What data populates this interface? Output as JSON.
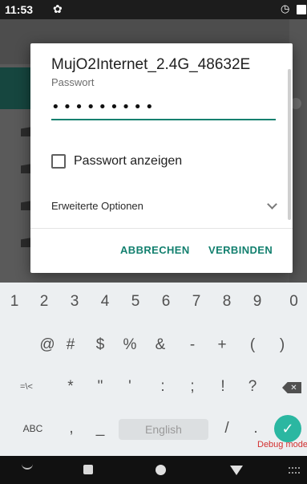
{
  "status_bar": {
    "time": "11:53",
    "left_icon": "gear-icon",
    "right_icons": [
      "alarm-icon",
      "battery-icon"
    ]
  },
  "dialog": {
    "title": "MujO2Internet_2.4G_48632E",
    "password_label": "Passwort",
    "password_value": "•••••••••",
    "show_password_label": "Passwort anzeigen",
    "show_password_checked": false,
    "advanced_options_label": "Erweiterte Optionen",
    "cancel_label": "ABBRECHEN",
    "connect_label": "VERBINDEN",
    "accent_color": "#13806f"
  },
  "keyboard": {
    "row1": [
      "1",
      "2",
      "3",
      "4",
      "5",
      "6",
      "7",
      "8",
      "9",
      "0"
    ],
    "row2": [
      "@",
      "#",
      "$",
      "%",
      "&",
      "-",
      "+",
      "(",
      ")"
    ],
    "row3": [
      "=\\<",
      "*",
      "\"",
      "'",
      ":",
      ";",
      "!",
      "?"
    ],
    "row4": {
      "abc": "ABC",
      "comma": ",",
      "underscore": "_",
      "space": "English",
      "slash": "/",
      "period": "."
    },
    "backspace_icon": "backspace-icon",
    "enter_icon": "check-icon",
    "enter_color": "#2bb7a1"
  },
  "debug_label": "Debug mode",
  "nav_bar": {
    "icons": [
      "nav-hide-keyboard-icon",
      "recents-icon",
      "home-icon",
      "back-icon",
      "keyboard-switch-icon"
    ]
  }
}
